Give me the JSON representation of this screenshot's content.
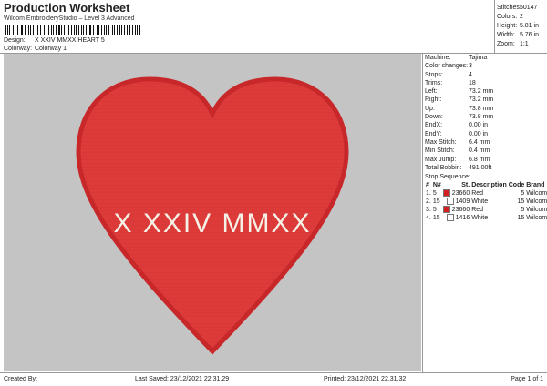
{
  "header": {
    "title": "Production Worksheet",
    "subtitle": "Wilcom EmbroideryStudio – Level 3 Advanced",
    "design_label": "Design:",
    "design_value": "X XXIV MMXX HEART 5",
    "colorway_label": "Colorway:",
    "colorway_value": "Colorway 1"
  },
  "stats": [
    {
      "label": "Stitches:",
      "value": "50147"
    },
    {
      "label": "Colors:",
      "value": "2"
    },
    {
      "label": "Height:",
      "value": "5.81 in"
    },
    {
      "label": "Width:",
      "value": "5.76 in"
    },
    {
      "label": "Zoom:",
      "value": "1:1"
    }
  ],
  "design_preview": {
    "text": "X XXIV MMXX",
    "heart_color": "#dd3a3a",
    "heart_outline_color": "#c8282a",
    "text_color": "#f4f1e6",
    "background_color": "#c4c4c4"
  },
  "info": [
    {
      "label": "Machine:",
      "value": "Tajima"
    },
    {
      "label": "Color changes:",
      "value": "3"
    },
    {
      "label": "Stops:",
      "value": "4"
    },
    {
      "label": "Trims:",
      "value": "18"
    },
    {
      "label": "Left:",
      "value": "73.2 mm"
    },
    {
      "label": "Right:",
      "value": "73.2 mm"
    },
    {
      "label": "Up:",
      "value": "73.8 mm"
    },
    {
      "label": "Down:",
      "value": "73.8 mm"
    },
    {
      "label": "EndX:",
      "value": "0.00 in"
    },
    {
      "label": "EndY:",
      "value": "0.00 in"
    },
    {
      "label": "Max Stitch:",
      "value": "6.4 mm"
    },
    {
      "label": "Min Stitch:",
      "value": "0.4 mm"
    },
    {
      "label": "Max Jump:",
      "value": "6.8 mm"
    },
    {
      "label": "Total Bobbin:",
      "value": "491.00ft"
    }
  ],
  "stop_sequence": {
    "title": "Stop Sequence:",
    "headers": [
      "#",
      "N#",
      "St.",
      "Description",
      "Code",
      "Brand"
    ],
    "rows": [
      {
        "index": "1.",
        "needle": "5",
        "stitches": "23660",
        "swatch": "#d42020",
        "description": "Red",
        "code": "5",
        "brand": "Wilcom"
      },
      {
        "index": "2.",
        "needle": "15",
        "stitches": "1409",
        "swatch": "#ffffff",
        "description": "White",
        "code": "15",
        "brand": "Wilcom"
      },
      {
        "index": "3.",
        "needle": "5",
        "stitches": "23660",
        "swatch": "#d42020",
        "description": "Red",
        "code": "5",
        "brand": "Wilcom"
      },
      {
        "index": "4.",
        "needle": "15",
        "stitches": "1416",
        "swatch": "#ffffff",
        "description": "White",
        "code": "15",
        "brand": "Wilcom"
      }
    ]
  },
  "footer": {
    "created_by": "Created By:",
    "last_saved": "Last Saved: 23/12/2021 22.31.29",
    "printed": "Printed: 23/12/2021 22.31.32",
    "page": "Page 1 of 1"
  }
}
